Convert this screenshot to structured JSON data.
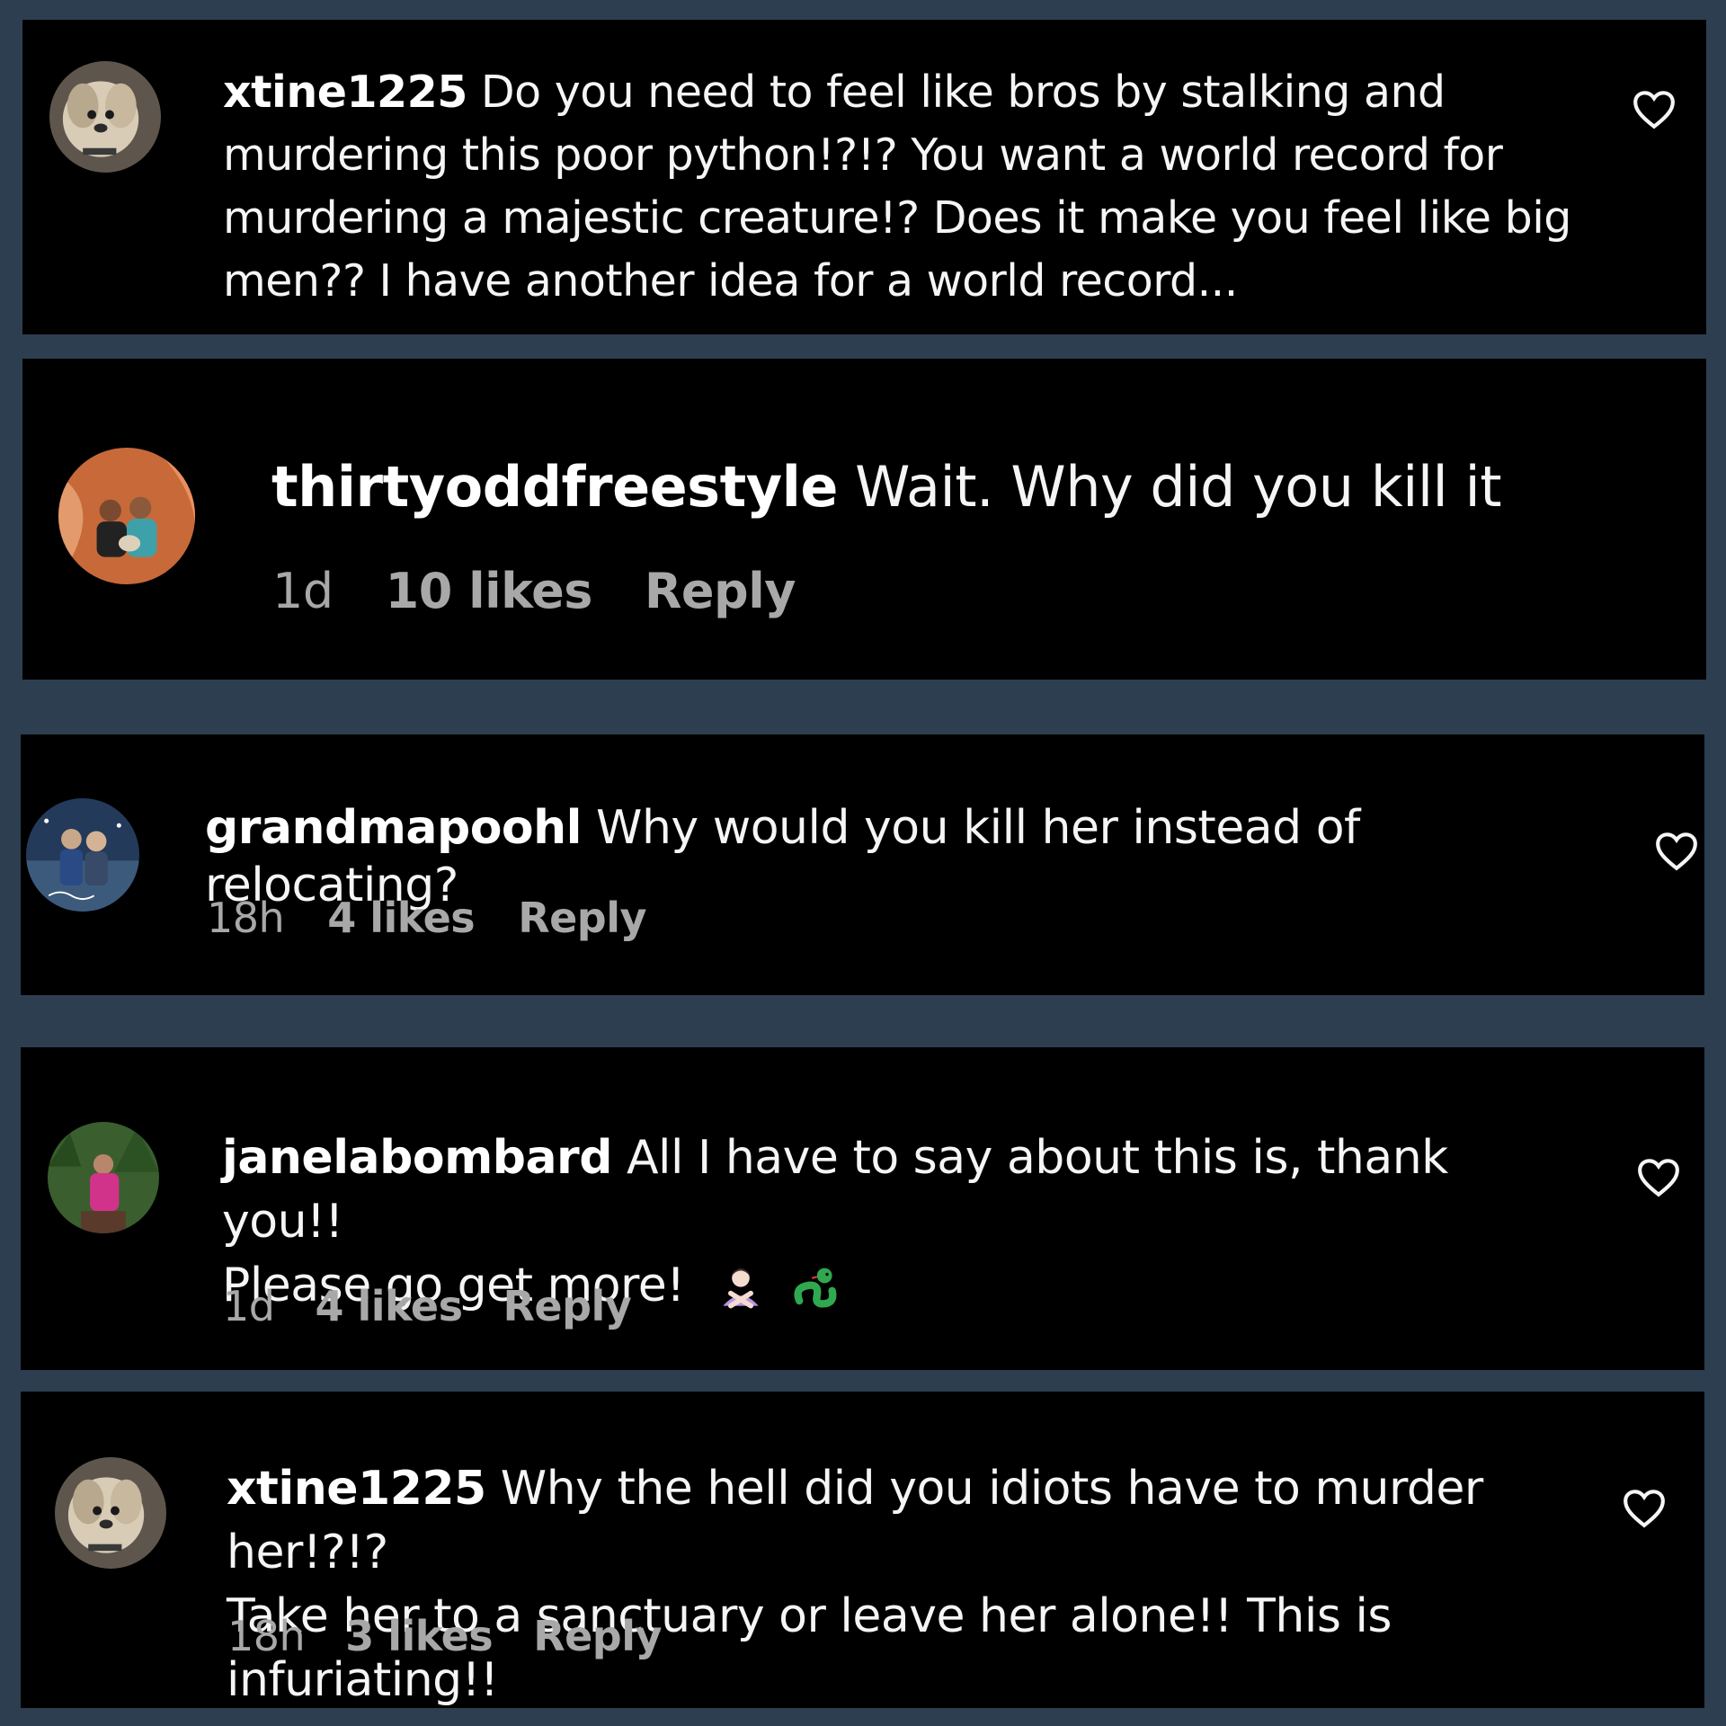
{
  "comments": [
    {
      "username": "xtine1225",
      "text": "Do you need to feel like bros by stalking and murdering this poor python!?!? You want a world record for murdering a majestic creature!? Does it make you feel like big men?? I have another idea for a world record..."
    },
    {
      "username": "thirtyoddfreestyle",
      "text": "Wait. Why did you kill it",
      "time": "1d",
      "likes": "10 likes",
      "reply": "Reply"
    },
    {
      "username": "grandmapoohl",
      "text": "Why would you kill her instead of relocating?",
      "time": "18h",
      "likes": "4 likes",
      "reply": "Reply"
    },
    {
      "username": "janelabombard",
      "text": "All I have to say about this is, thank you!!",
      "text2": "Please go get more!",
      "emojis": [
        "person-gesturing-no-emoji",
        "snake-emoji"
      ],
      "time": "1d",
      "likes": "4 likes",
      "reply": "Reply"
    },
    {
      "username": "xtine1225",
      "text": "Why the hell did you idiots have to murder her!?!?",
      "text2": "Take her to a sanctuary or leave her alone!! This is infuriating!!",
      "time": "18h",
      "likes": "3 likes",
      "reply": "Reply"
    }
  ],
  "colors": {
    "background": "#2d3e50",
    "card": "#000000",
    "text": "#f5f5f5",
    "meta": "#a8a8a8"
  }
}
